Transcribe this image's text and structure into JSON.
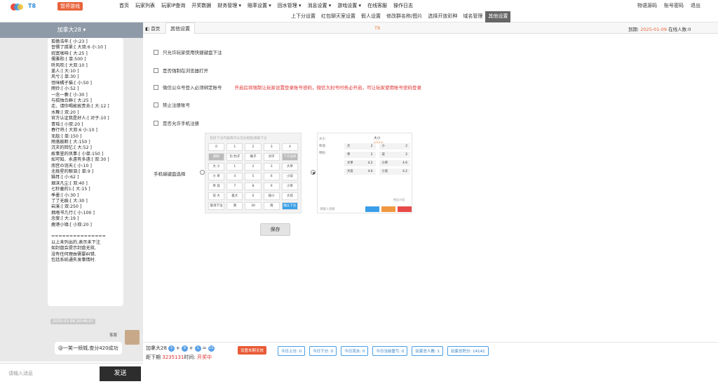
{
  "app": {
    "brand": "T8",
    "pause_label": "暂停游戏"
  },
  "nav_primary": [
    "首页",
    "玩家列表",
    "玩家IP查询",
    "开奖数据",
    "财务管理 ▾",
    "赔率设置 ▾",
    "回水管理 ▾",
    "消息设置 ▾",
    "游戏设置 ▾",
    "在线客服",
    "操作日志"
  ],
  "nav_right": [
    "物语源码",
    "账号密码",
    "退出"
  ],
  "nav_secondary": [
    "上下分设置",
    "红包聊天室设置",
    "假人设置",
    "修改群名称/图片",
    "选择开放彩种",
    "域名管理",
    "其他设置"
  ],
  "chat": {
    "header": "加拿大28 ▾",
    "lines": [
      "孤傲浩年:[ 小:23 ]",
      "習慣了孤單:[ 大双:6 小:10 ]",
      "寂寞咖啡:[ 大:25 ]",
      "儒雅败:[ 单:500 ]",
      "听风吹:[ 大双:10 ]",
      "盖人:[ 大:10 ]",
      "风兮:[ 单:30 ]",
      "怪咪橘子猫:[ 小:50 ]",
      "雨铃:[ 小:52 ]",
      "一念一蓑:[ 小:30 ]",
      "与孤独合群:[ 大:25 ]",
      "走、请你喝故故贵去:[ 大:12 ]",
      "水舞:[ 双:20 ]",
      "官方认证我是好人:[ 对子:10 ]",
      "青瑶:[ 小双:20 ]",
      "春行将:[ 大双:6 小:10 ]",
      "无敌:[ 单:150 ]",
      "雨落敲断:[ 大:150 ]",
      "沉夫的回忆:[ 大:52 ]",
      "故事里的凤事:[ 小单:150 ]",
      "如可知、永遠有多遠:[ 双:30 ]",
      "南宫の羽天:[ 小:10 ]",
      "北极星的眼泪:[ 单:9 ]",
      "猫耳:[ 小:62 ]",
      "烟沫凡尘:[ 双:40 ]",
      "七秒童的1:[ 大:15 ]",
      "季墨:[ 小:30 ]",
      "了了无痕:[ 大:30 ]",
      "岩溪:[ 双:250 ]",
      "拥堵书几行:[ 小:100 ]",
      "念斐:[ 大:19 ]",
      "鹿港小镇:[ 小双:20 ]",
      "",
      "===============",
      "以上未列出的,表示未下注",
      "如封盘会提示封盘无效,",
      "没有任何理由需要纠错,",
      "包括系统通失发事情时."
    ],
    "timestamp": "2025-01-08 20:46:57",
    "sender": "客服",
    "reply": "@一笑一倾城,查分420成功",
    "input_placeholder": "请输入消息",
    "send_label": "发送"
  },
  "main": {
    "tab_home": "◧ 首页",
    "tab_other": "其他设置",
    "title": "T8",
    "expire_label": "到期:",
    "expire_date": "2025-01-09",
    "online_label": "在线人数:0",
    "options": [
      {
        "label": "只允许玩家使用快捷键盘下注"
      },
      {
        "label": "是否强制在浏览器打开"
      },
      {
        "label": "微信公众号登入必须绑定账号",
        "note": "开启后将强制让玩家设置登录账号密码，微信大封号时务必开启，可让玩家使用账号密码登录"
      },
      {
        "label": "禁止注册账号"
      },
      {
        "label": "是否允许手机注册"
      }
    ],
    "keyboard_label": "手机端键盘选择",
    "save_label": "保存",
    "kb1_search": "包括下注内容再可以在此框起请输下注",
    "kb1_keys": [
      "0",
      "1",
      "2",
      "3",
      "4",
      "删除",
      "包\n豹子",
      "顺子",
      "对子",
      "下方选择",
      "大\n小",
      "1",
      "2",
      "3",
      "大单",
      "小\n单",
      "4",
      "5",
      "6",
      "小双",
      "单\n双",
      "7",
      "8",
      "9",
      "小单",
      "双\n大",
      "极大",
      "0",
      "极小",
      "大双",
      "取消下注",
      "清",
      "30",
      "清",
      "确认下注"
    ],
    "kb2_side": [
      "大小",
      "和值",
      "特码"
    ],
    "kb2_head": "大小",
    "kb2_sub": "0/5/1/5",
    "kb2_cells": [
      [
        "大",
        "2"
      ],
      [
        "小",
        "2"
      ],
      [
        "单",
        "2"
      ],
      [
        "双",
        "2"
      ],
      [
        "大单",
        "4.2"
      ],
      [
        "小单",
        "4.6"
      ],
      [
        "大双",
        "4.6"
      ],
      [
        "小双",
        "4.2"
      ]
    ],
    "kb2_rule": "特达介绍",
    "kb2_input": "请输入金额"
  },
  "bottom": {
    "game": "加拿大28",
    "balls": [
      "3",
      "9",
      "1",
      "13"
    ],
    "period_label": "距下期",
    "period": "3235131",
    "time_label": "时间:",
    "status": "开奖中",
    "set_btn": "设置本期无效",
    "stats": [
      "今日上分: 0",
      "今日下分: 0",
      "今日流水: 0",
      "今日当前盈亏: 0",
      "玩家总人数: 1",
      "玩家总积分: 14141"
    ]
  }
}
